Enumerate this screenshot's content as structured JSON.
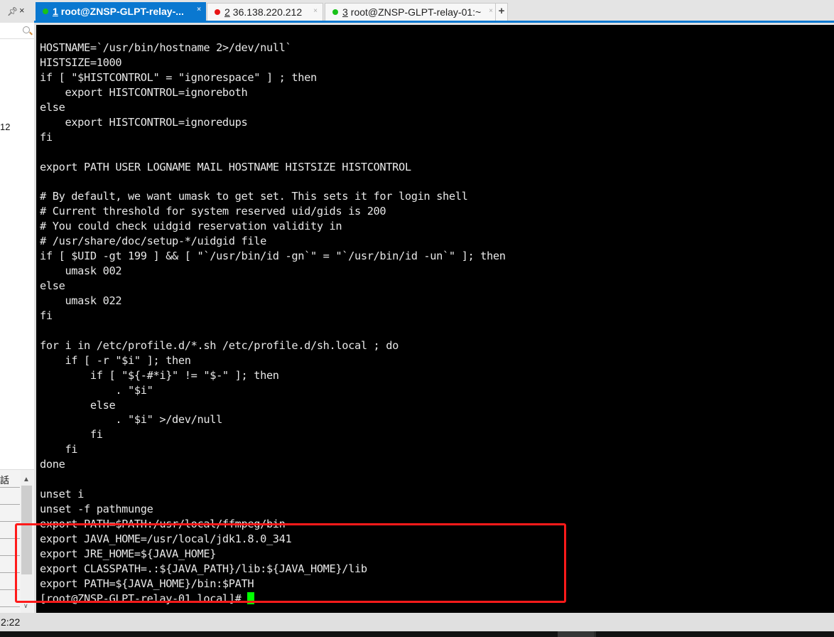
{
  "sidebar": {
    "pin_icon": "pin-icon",
    "close_icon": "close-icon",
    "search_placeholder": "",
    "partial_text": "12",
    "list_header": "話",
    "scroll_up": "^",
    "scroll_down": "v"
  },
  "tabs": [
    {
      "number": "1",
      "label": "root@ZNSP-GLPT-relay-...",
      "status_color": "#19c219",
      "active": true
    },
    {
      "number": "2",
      "label": "36.138.220.212",
      "status_color": "#e81515",
      "active": false
    },
    {
      "number": "3",
      "label": "root@ZNSP-GLPT-relay-01:~",
      "status_color": "#19c219",
      "active": false
    }
  ],
  "tab_close_glyph": "×",
  "new_tab_glyph": "+",
  "terminal": {
    "lines": [
      "HOSTNAME=`/usr/bin/hostname 2>/dev/null`",
      "HISTSIZE=1000",
      "if [ \"$HISTCONTROL\" = \"ignorespace\" ] ; then",
      "    export HISTCONTROL=ignoreboth",
      "else",
      "    export HISTCONTROL=ignoredups",
      "fi",
      "",
      "export PATH USER LOGNAME MAIL HOSTNAME HISTSIZE HISTCONTROL",
      "",
      "# By default, we want umask to get set. This sets it for login shell",
      "# Current threshold for system reserved uid/gids is 200",
      "# You could check uidgid reservation validity in",
      "# /usr/share/doc/setup-*/uidgid file",
      "if [ $UID -gt 199 ] && [ \"`/usr/bin/id -gn`\" = \"`/usr/bin/id -un`\" ]; then",
      "    umask 002",
      "else",
      "    umask 022",
      "fi",
      "",
      "for i in /etc/profile.d/*.sh /etc/profile.d/sh.local ; do",
      "    if [ -r \"$i\" ]; then",
      "        if [ \"${-#*i}\" != \"$-\" ]; then",
      "            . \"$i\"",
      "        else",
      "            . \"$i\" >/dev/null",
      "        fi",
      "    fi",
      "done",
      "",
      "unset i",
      "unset -f pathmunge",
      "export PATH=$PATH:/usr/local/ffmpeg/bin",
      "export JAVA_HOME=/usr/local/jdk1.8.0_341",
      "export JRE_HOME=${JAVA_HOME}",
      "export CLASSPATH=.:${JAVA_PATH}/lib:${JAVA_HOME}/lib",
      "export PATH=${JAVA_HOME}/bin:$PATH"
    ],
    "prompt": "[root@ZNSP-GLPT-relay-01 local]# ",
    "cursor_color": "#00ff00"
  },
  "annotation": {
    "color": "#ff1a1a"
  },
  "statusbar": {
    "time": "2:22"
  }
}
